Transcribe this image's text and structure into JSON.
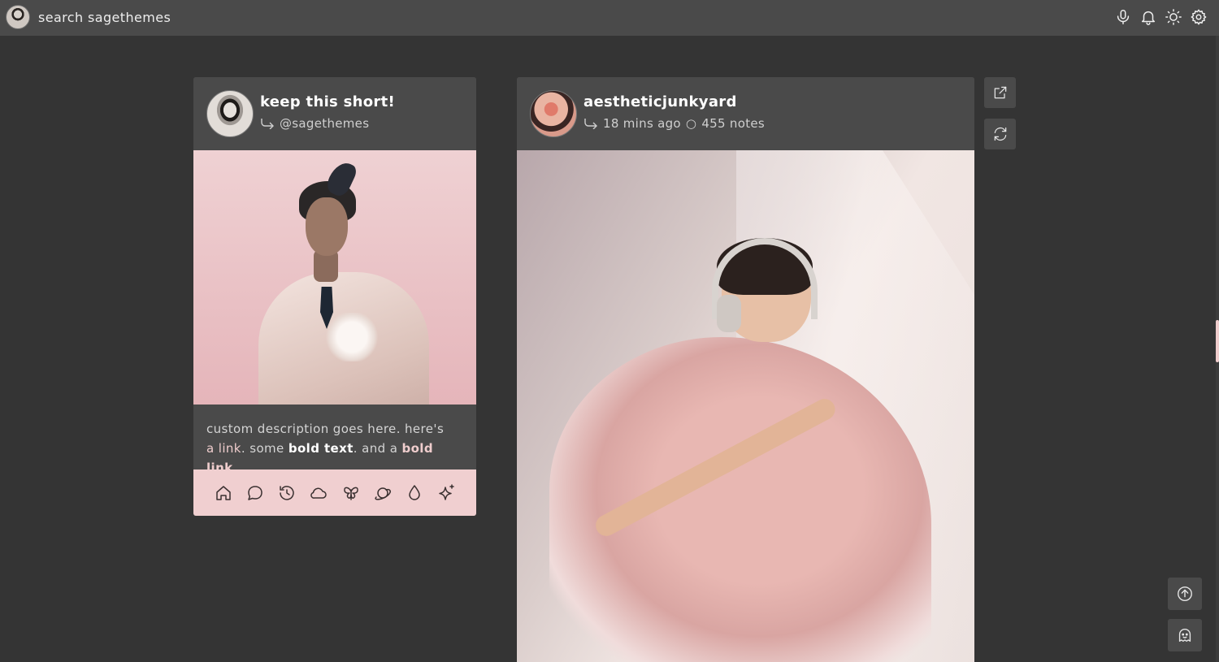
{
  "topbar": {
    "search_label": "search sagethemes",
    "icons": [
      "microphone-icon",
      "bell-icon",
      "sun-icon",
      "gear-icon"
    ]
  },
  "post1": {
    "title": "keep this short!",
    "handle": "@sagethemes",
    "description": {
      "line1": "custom description goes here. here's",
      "link1": "a link",
      "text2": ". some ",
      "bold": "bold text",
      "text3": ". and a ",
      "bold_link": "bold link",
      "end": "."
    },
    "icon_bar": [
      "home-icon",
      "chat-bubble-icon",
      "history-icon",
      "cloud-icon",
      "butterfly-icon",
      "planet-icon",
      "droplet-icon",
      "sparkle-icon"
    ]
  },
  "post2": {
    "username": "aestheticjunkyard",
    "time": "18 mins ago",
    "separator": "○",
    "notes": "455 notes"
  },
  "side_buttons": [
    "external-link-icon",
    "refresh-icon"
  ],
  "corner_buttons": [
    "arrow-up-circle-icon",
    "ghost-icon"
  ],
  "colors": {
    "background": "#343434",
    "panel": "#4a4a4a",
    "accent_pink": "#f0cfd0"
  }
}
